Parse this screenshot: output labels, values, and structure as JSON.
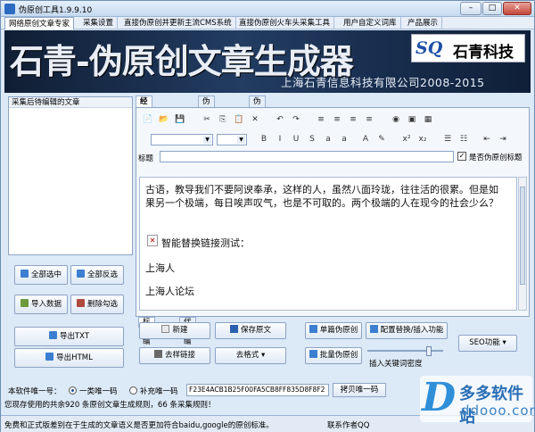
{
  "window": {
    "title": "伪原创工具1.9.9.10",
    "min_label": "–",
    "max_label": "□",
    "close_label": "✕"
  },
  "menu": [
    {
      "label": "网络原创文章专家"
    },
    {
      "label": "采集设置"
    },
    {
      "label": "直接伪原创并更新主流CMS系统"
    },
    {
      "label": "直接伪原创火车头采集工具"
    },
    {
      "label": "用户自定义词库"
    },
    {
      "label": "产品展示"
    }
  ],
  "banner": {
    "title": "石青-伪原创文章生成器",
    "company": "上海石青信息科技有限公司2008-2015",
    "logo_mark": "SQ",
    "logo_name": "石青科技"
  },
  "left": {
    "header": "采集后待编辑的文章",
    "buttons": {
      "select_all": "全部选中",
      "invert": "全部反选",
      "import": "导入数据",
      "delete": "删除勾选",
      "export_txt": "导出TXT",
      "export_html": "导出HTML"
    }
  },
  "tabs": [
    {
      "label": "经典方式伪原创"
    },
    {
      "label": "伪原创结果"
    },
    {
      "label": "伪原创配置"
    }
  ],
  "editor": {
    "title_label": "标题",
    "title_value": "",
    "checkbox_label": "是否伪原创标题",
    "checkbox_checked": true,
    "font_select": "",
    "size_select": "",
    "toolbar1": [
      "new-doc",
      "open",
      "save",
      "cut",
      "copy",
      "paste",
      "delete",
      "undo",
      "redo",
      "align-left",
      "align-center",
      "align-right",
      "align-justify",
      "web-icon",
      "image",
      "table"
    ],
    "toolbar2": [
      "bold",
      "italic",
      "underline",
      "strike",
      "superscript-s",
      "subscript-s",
      "font-color",
      "highlight",
      "superscript",
      "subscript",
      "list",
      "bullets",
      "outdent",
      "indent"
    ],
    "toolbar1_glyphs": [
      "📄",
      "📂",
      "💾",
      "✂",
      "⎘",
      "📋",
      "✕",
      "↶",
      "↷",
      "≡",
      "≡",
      "≡",
      "≡",
      "◉",
      "▣",
      "▦"
    ],
    "toolbar2_glyphs": [
      "B",
      "I",
      "U",
      "S",
      "a",
      "a",
      "A",
      "✎",
      "x²",
      "x₂",
      "☰",
      "☷",
      "⇤",
      "⇥"
    ],
    "content": {
      "para1": "古语，教导我们不要阿谀奉承，这样的人，虽然八面玲珑，往往活的很累。但是如果另一个极端，每日唉声叹气，也是不可取的。两个极端的人在现今的社会少么？",
      "broken_image": "✕",
      "link_test": "智能替换链接测试：",
      "line1": "上海人",
      "line2": "上海人论坛"
    },
    "bottom_tabs": [
      {
        "label": "标准编辑"
      },
      {
        "label": "代码编辑"
      }
    ]
  },
  "actions": {
    "new": "新建",
    "save_original": "保存原文",
    "single_pseudo": "单篇伪原创",
    "config_replace": "配置替换/插入功能",
    "remove_links": "去样链接",
    "remove_format": "去格式",
    "batch_pseudo": "批量伪原创",
    "insert_density": "插入关键词密度",
    "seo": "SEO功能",
    "insert_density_value": 0.85
  },
  "license": {
    "label": "本软件唯一号：",
    "opt1": "一类唯一码",
    "opt2": "补充唯一码",
    "selected": "一类唯一码",
    "key": "F23E4ACB1B25F00FA5CB8FF835D8F8F2",
    "copy_button": "拷贝唯一码"
  },
  "info_line": "您现存使用的共余920 条原创文章生成规则，66 条采集规则！",
  "status": {
    "left": "免费和正式版差别在于生成的文章语义是否更加符合baidu,google的原创标准。",
    "right": "联系作者QQ"
  },
  "watermark": {
    "mark": "D",
    "name": "多多软件站",
    "url": "ddooo.com"
  },
  "colors": {
    "accent": "#2b6bc1",
    "banner_bg": "#1a2f4f",
    "link_blue": "#1e4fa5"
  }
}
